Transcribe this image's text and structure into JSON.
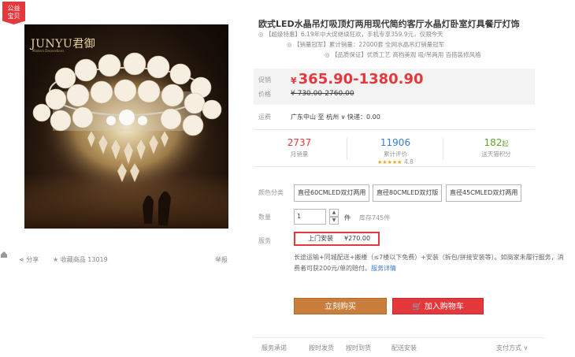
{
  "badge": {
    "line1": "公益",
    "line2": "宝贝"
  },
  "image": {
    "brand": "JUNYU君御",
    "brand_sub": "Modern Decorations"
  },
  "actions": {
    "share": "分享",
    "favorite": "收藏商品 13019",
    "report": "举报"
  },
  "product": {
    "title": "欧式LED水晶吊灯吸顶灯两用现代简约客厅水晶灯卧室灯具餐厅灯饰",
    "promos": [
      "【超级特惠】6.19年中大促继续狂欢，手机专享359.9元，仅限今天",
      "【销量冠军】累计销量：22000套 全网水晶吊灯销量冠军",
      "【品质保证】优质工艺 高档美观 吸/吊两用 百搭装修风格"
    ]
  },
  "price": {
    "label_current": "促销",
    "label_original": "价格",
    "current": "365.90-1380.90",
    "currency": "¥",
    "original": "¥ 730.00-2760.00"
  },
  "shipping": {
    "label": "运费",
    "value": "广东中山 至 杭州 ∨ 快递：0.00"
  },
  "stats": {
    "sales": {
      "num": "2737",
      "label": "月销量"
    },
    "reviews": {
      "num": "11906",
      "label": "累计评价",
      "rating": "4.8",
      "stars": "★★★★★"
    },
    "points": {
      "num": "182",
      "num_suffix": "起",
      "label": "送天猫积分"
    }
  },
  "options": {
    "color_label": "颜色分类",
    "skus": [
      "直径60CMLED双灯两用",
      "直径80CMLED双灯版",
      "直径45CMLED双灯两用"
    ],
    "qty_label": "数量",
    "qty_value": "1",
    "qty_unit": "件",
    "stock": "库存745件",
    "service_label": "服务",
    "service_name": "上门安装",
    "service_price": "¥270.00",
    "service_desc": "长途运输+同城配送+搬楼（≤7楼以下免费）+安装（拆包/拼接安装等）。如商家未履行服务，消费者可获200元/单的赔付。",
    "service_link": "服务详情"
  },
  "buttons": {
    "buy": "立刻购买",
    "cart": "加入购物车"
  },
  "bottom": {
    "label": "服务承诺",
    "items": [
      "按时发货",
      "按时到货",
      "配送安装"
    ],
    "payment": "支付方式 ∨"
  },
  "colors": {
    "accent": "#e4393c",
    "buy": "#c97e3c",
    "link": "#3b7ecd",
    "green": "#5ba22c"
  }
}
